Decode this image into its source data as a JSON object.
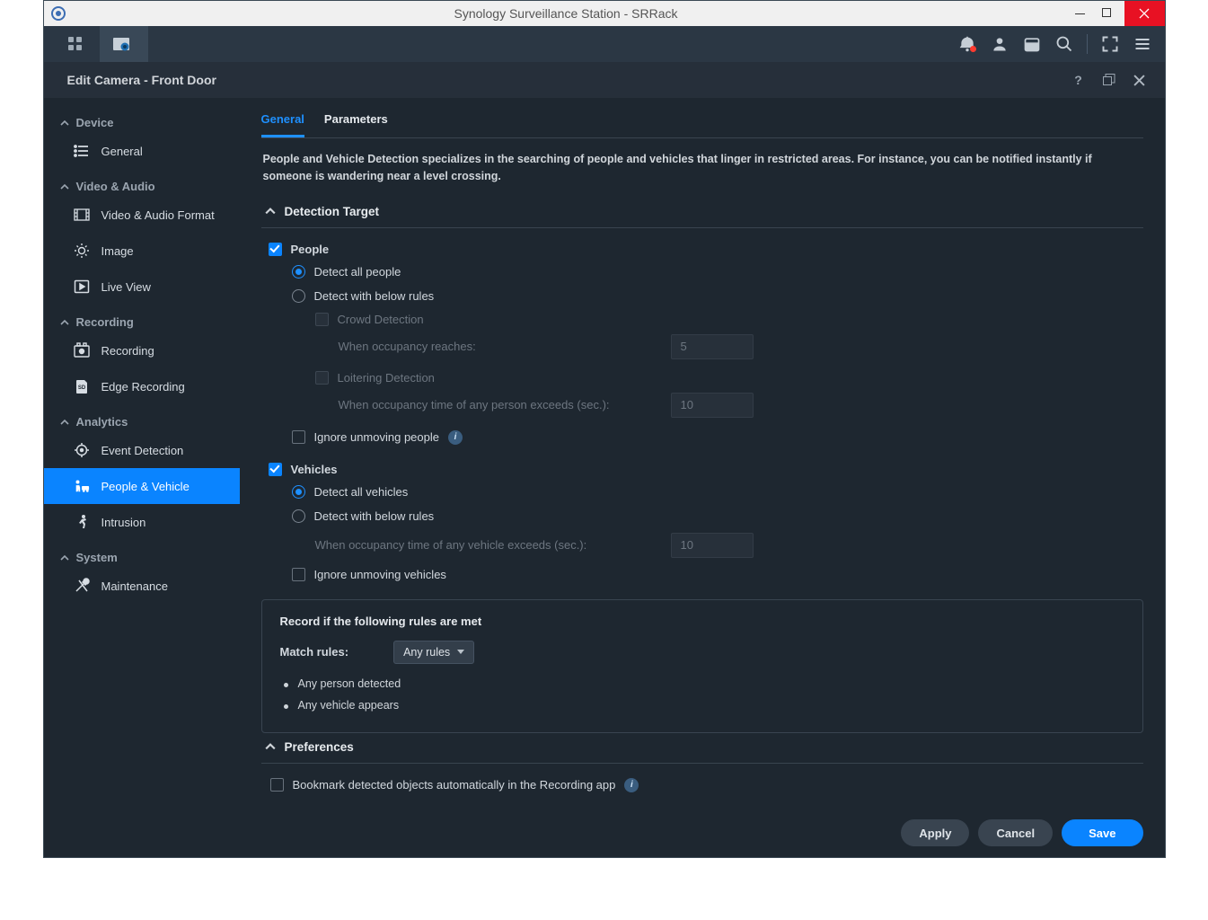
{
  "window": {
    "title": "Synology Surveillance Station - SRRack"
  },
  "panel": {
    "title": "Edit Camera - Front Door"
  },
  "sidebar": {
    "device": {
      "header": "Device",
      "items": [
        {
          "label": "General"
        }
      ]
    },
    "video": {
      "header": "Video & Audio",
      "items": [
        {
          "label": "Video & Audio Format"
        },
        {
          "label": "Image"
        },
        {
          "label": "Live View"
        }
      ]
    },
    "recording": {
      "header": "Recording",
      "items": [
        {
          "label": "Recording"
        },
        {
          "label": "Edge Recording"
        }
      ]
    },
    "analytics": {
      "header": "Analytics",
      "items": [
        {
          "label": "Event Detection"
        },
        {
          "label": "People & Vehicle"
        },
        {
          "label": "Intrusion"
        }
      ]
    },
    "system": {
      "header": "System",
      "items": [
        {
          "label": "Maintenance"
        }
      ]
    }
  },
  "tabs": {
    "general": "General",
    "parameters": "Parameters"
  },
  "description": "People and Vehicle Detection specializes in the searching of people and vehicles that linger in restricted areas. For instance, you can be notified instantly if someone is wandering near a level crossing.",
  "sections": {
    "detection_target": "Detection Target",
    "preferences": "Preferences"
  },
  "people": {
    "label": "People",
    "detect_all": "Detect all people",
    "detect_rules": "Detect with below rules",
    "crowd": "Crowd Detection",
    "occupancy_label": "When occupancy reaches:",
    "occupancy_value": "5",
    "loitering": "Loitering Detection",
    "loiter_label": "When occupancy time of any person exceeds (sec.):",
    "loiter_value": "10",
    "ignore": "Ignore unmoving people"
  },
  "vehicles": {
    "label": "Vehicles",
    "detect_all": "Detect all vehicles",
    "detect_rules": "Detect with below rules",
    "occ_label": "When occupancy time of any vehicle exceeds (sec.):",
    "occ_value": "10",
    "ignore": "Ignore unmoving vehicles"
  },
  "rules_box": {
    "title": "Record if the following rules are met",
    "match_label": "Match rules:",
    "match_value": "Any rules",
    "rules": [
      "Any person detected",
      "Any vehicle appears"
    ]
  },
  "preferences": {
    "bookmark": "Bookmark detected objects automatically in the Recording app"
  },
  "footer": {
    "apply": "Apply",
    "cancel": "Cancel",
    "save": "Save"
  }
}
